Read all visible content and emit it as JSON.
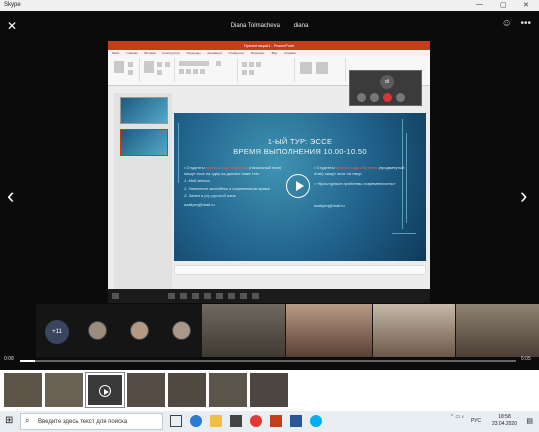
{
  "window": {
    "title": "Skype"
  },
  "call": {
    "name1": "Diana Tolmacheva",
    "name2": "diana"
  },
  "ppt": {
    "title": "Презентация1 - PowerPoint",
    "tabs": [
      "Файл",
      "Главная",
      "Вставка",
      "Конструктор",
      "Переходы",
      "Анимация",
      "Слайд-шоу",
      "Рецензир.",
      "Вид",
      "Справка"
    ],
    "minivideo_initials": "di"
  },
  "slide": {
    "title_line1": "1-ЫЙ ТУР: ЭССЕ",
    "title_line2": "ВРЕМЯ ВЫПОЛНЕНИЯ 10.00-10.50",
    "left": {
      "intro_pre": "Студенты",
      "intro_red": "первого года обучения",
      "intro_post": "(начальный этап) пишут эссе на одну из данных ниже тем.",
      "items": [
        "Мой мечта",
        "Увлечение молодёжи в современном время",
        "Зачем я учу русский язык"
      ],
      "email": "azaliyeq@mail.ru"
    },
    "right": {
      "intro_pre": "Студенты",
      "intro_red": "второго года обучения",
      "intro_post": "(продвинутый этап) пишут эссе на тему:",
      "item": "«Культурные проблемы современности»",
      "email": "azaliyeq@mail.ru"
    }
  },
  "strip": {
    "more_count": "+11"
  },
  "timeline": {
    "elapsed": "0:08",
    "total": "5:05",
    "progress": 0.03
  },
  "taskbar": {
    "search_placeholder": "Введите здесь текст для поиска",
    "lang": "РУС",
    "time": "18:58",
    "date": "23.04.2020"
  },
  "colors": {
    "ppt_accent": "#c43e1c",
    "slide_bg": "#20618a",
    "red_text": "#ff5a4a"
  }
}
